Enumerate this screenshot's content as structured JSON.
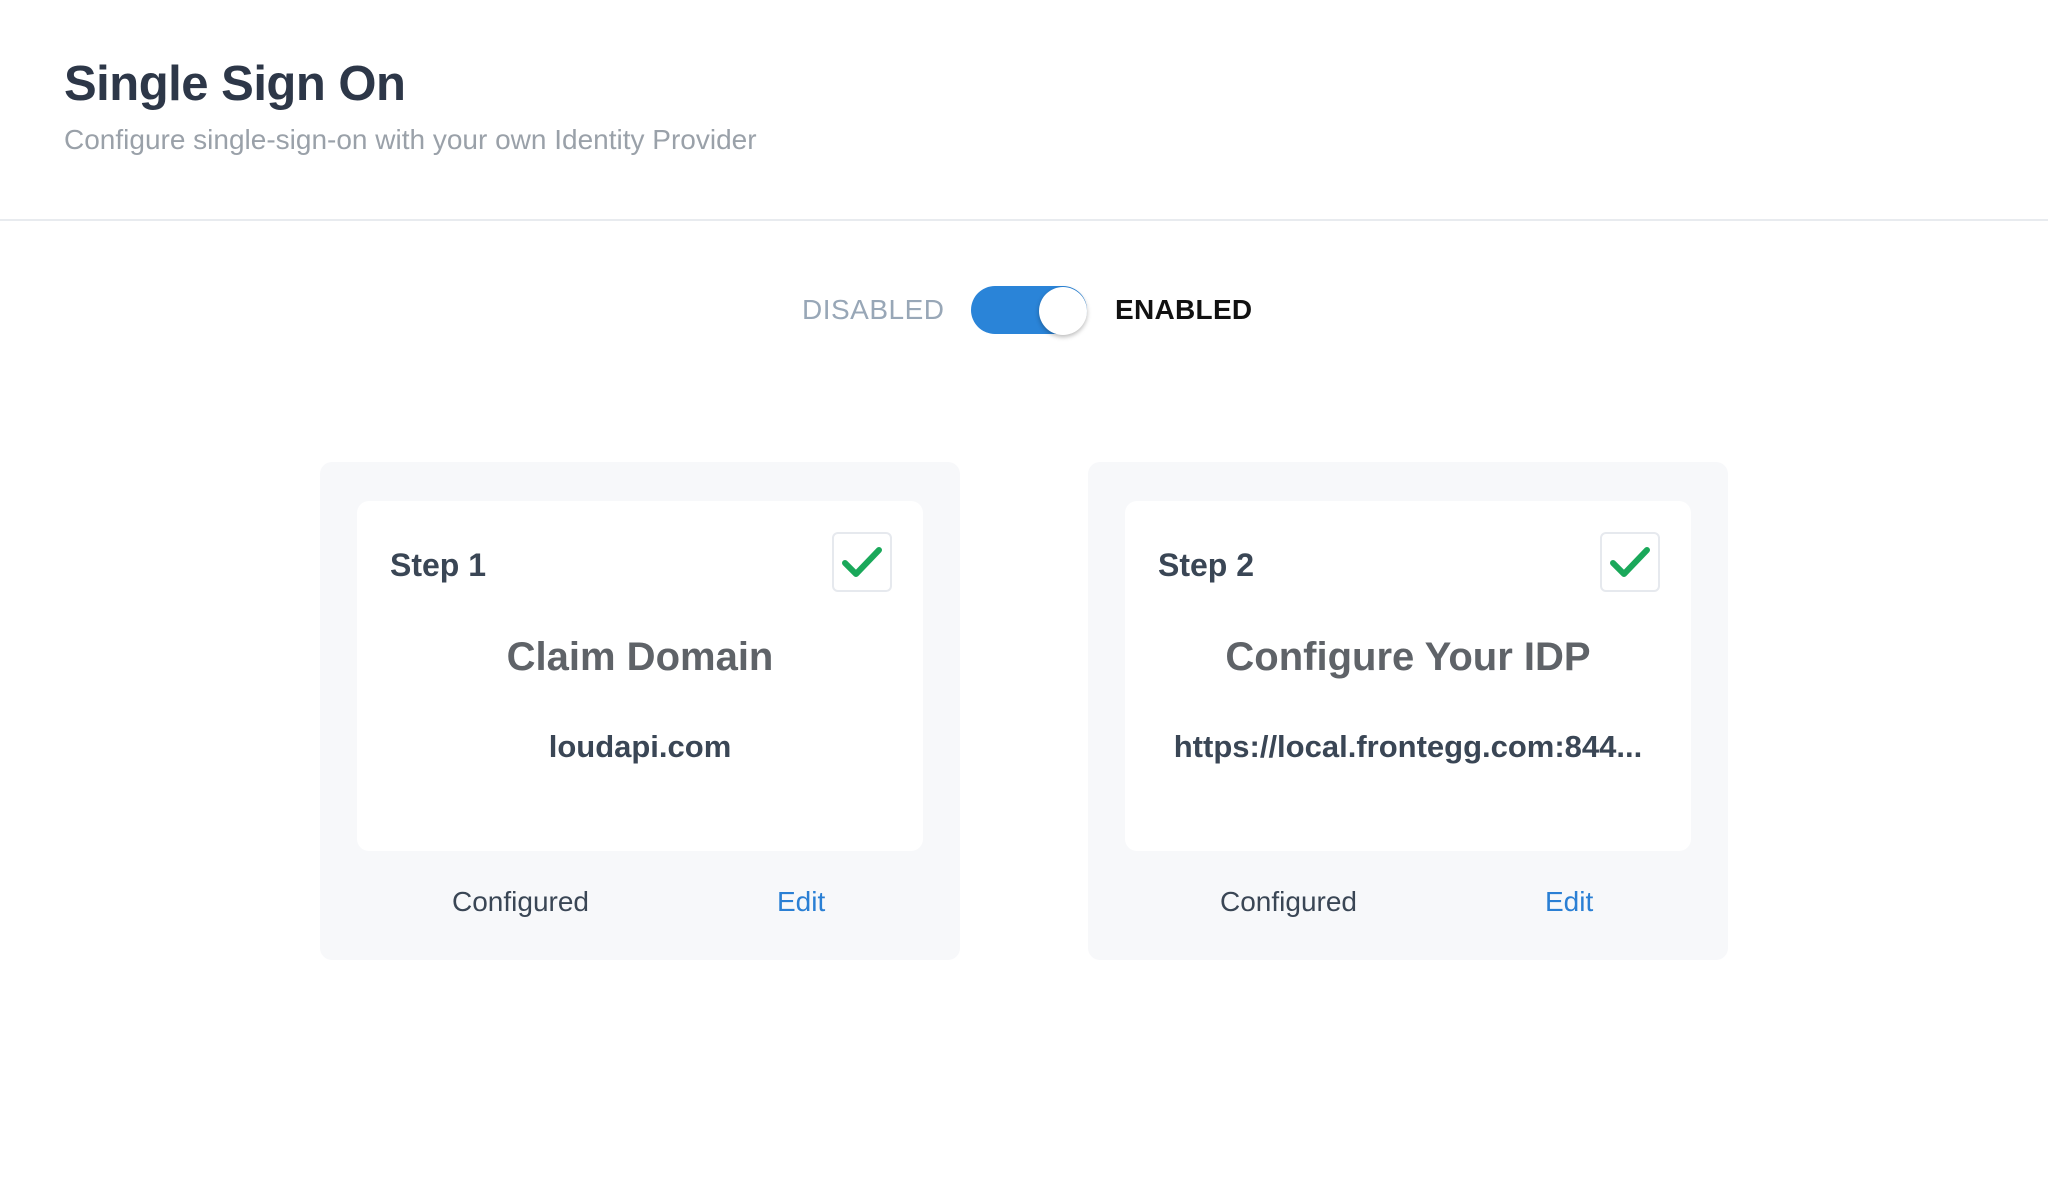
{
  "header": {
    "title": "Single Sign On",
    "subtitle": "Configure single-sign-on with your own Identity Provider"
  },
  "toggle": {
    "disabled_label": "DISABLED",
    "enabled_label": "ENABLED",
    "state": "enabled",
    "accent_color": "#2a84d8"
  },
  "steps": [
    {
      "step_label": "Step 1",
      "title": "Claim Domain",
      "value": "loudapi.com",
      "status": "Configured",
      "action": "Edit",
      "checked": true,
      "icon": "checkmark-icon"
    },
    {
      "step_label": "Step 2",
      "title": "Configure Your IDP",
      "value": "https://local.frontegg.com:844...",
      "status": "Configured",
      "action": "Edit",
      "checked": true,
      "icon": "checkmark-icon"
    }
  ],
  "colors": {
    "check_green": "#1aa85a",
    "link_blue": "#2a7fd4",
    "card_bg": "#f7f8fa"
  }
}
